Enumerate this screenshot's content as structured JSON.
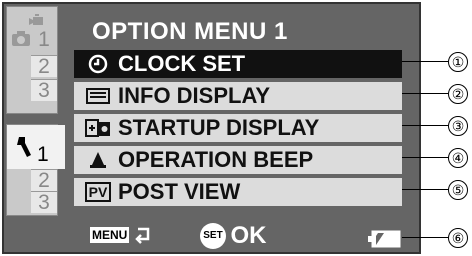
{
  "menu": {
    "title": "OPTION MENU 1",
    "items": [
      {
        "label": "CLOCK SET",
        "icon": "clock-icon",
        "selected": true
      },
      {
        "label": "INFO DISPLAY",
        "icon": "info-display-icon",
        "selected": false
      },
      {
        "label": "STARTUP DISPLAY",
        "icon": "startup-display-icon",
        "selected": false
      },
      {
        "label": "OPERATION BEEP",
        "icon": "bell-icon",
        "selected": false
      },
      {
        "label": "POST VIEW",
        "icon": "pv-icon",
        "icon_text": "PV",
        "selected": false
      }
    ]
  },
  "sidebar": {
    "camera_tabs": [
      "1",
      "2",
      "3"
    ],
    "settings_tabs": [
      "1",
      "2",
      "3"
    ]
  },
  "footer": {
    "menu_label": "MENU",
    "set_label": "SET",
    "ok_label": "OK"
  },
  "callouts": [
    "①",
    "②",
    "③",
    "④",
    "⑤",
    "⑥"
  ]
}
